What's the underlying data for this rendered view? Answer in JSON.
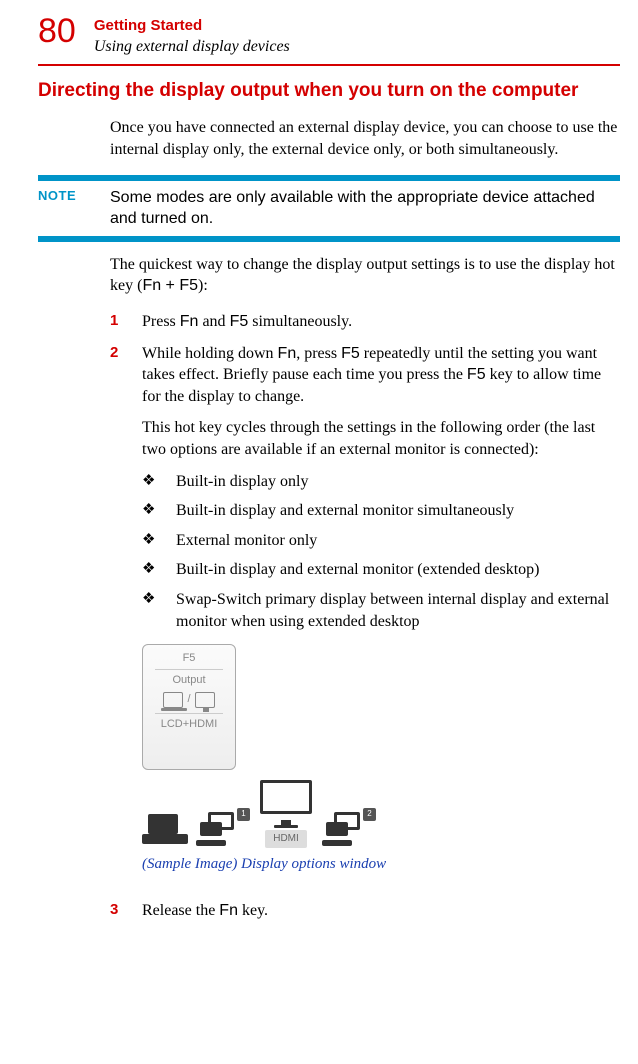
{
  "header": {
    "page_number": "80",
    "chapter": "Getting Started",
    "section": "Using external display devices"
  },
  "heading": "Directing the display output when you turn on the computer",
  "intro": "Once you have connected an external display device, you can choose to use the internal display only, the external device only, or both simultaneously.",
  "note": {
    "label": "NOTE",
    "text": "Some modes are only available with the appropriate device attached and turned on."
  },
  "para_hotkey_1": "The quickest way to change the display output settings is to use the display hot key (",
  "hotkey_combo": "Fn + F5",
  "para_hotkey_2": "):",
  "steps": [
    {
      "num": "1",
      "parts": [
        "Press ",
        "Fn",
        " and ",
        "F5",
        " simultaneously."
      ]
    },
    {
      "num": "2",
      "line1_parts": [
        "While holding down ",
        "Fn",
        ", press ",
        "F5",
        " repeatedly until the setting you want takes effect. Briefly pause each time you press the ",
        "F5",
        " key to allow time for the display to change."
      ],
      "line2": "This hot key cycles through the settings in the following order (the last two options are available if an external monitor is connected):",
      "bullets": [
        "Built-in display only",
        "Built-in display and external monitor simultaneously",
        "External monitor only",
        "Built-in display and external monitor (extended desktop)",
        "Swap-Switch primary display between internal display and external monitor when using extended desktop"
      ]
    },
    {
      "num": "3",
      "parts": [
        "Release the ",
        "Fn",
        " key."
      ]
    }
  ],
  "figure": {
    "card": {
      "key": "F5",
      "label": "Output",
      "sub": "LCD+HDMI"
    },
    "hdmi_tag": "HDMI",
    "caption": "(Sample Image) Display options window"
  }
}
